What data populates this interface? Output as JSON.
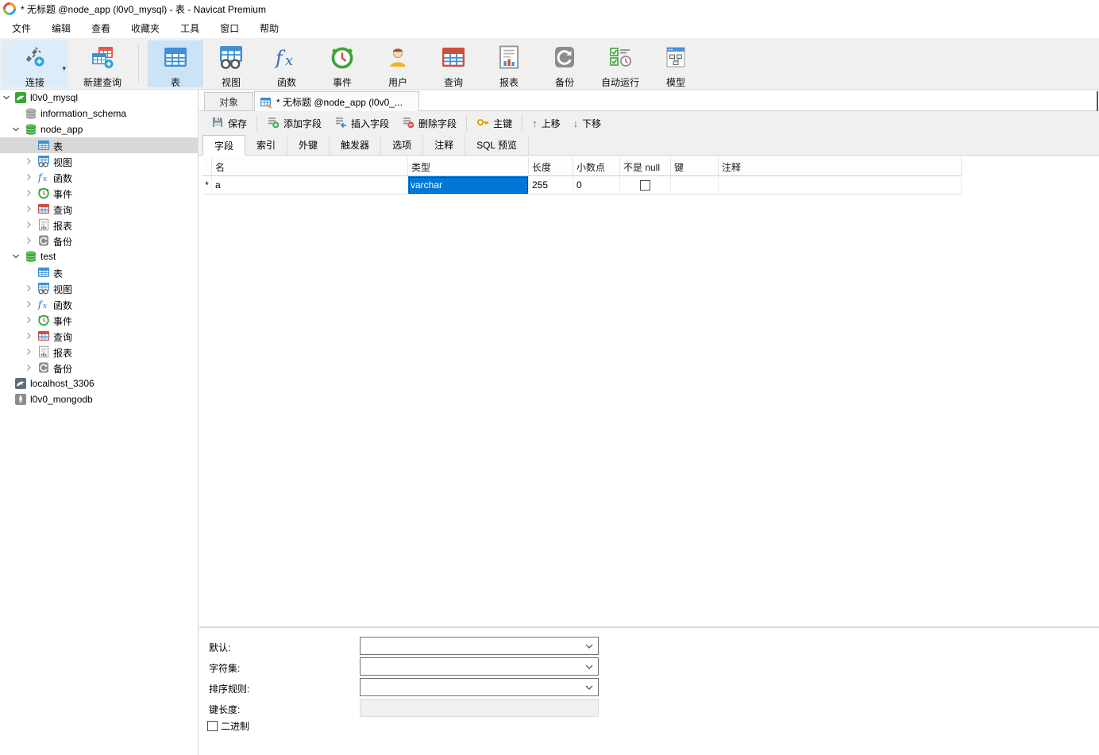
{
  "window": {
    "title": "* 无标题 @node_app (l0v0_mysql) - 表 - Navicat Premium",
    "app_icon": "navicat-logo-icon"
  },
  "menu_bar": {
    "items": [
      "文件",
      "编辑",
      "查看",
      "收藏夹",
      "工具",
      "窗口",
      "帮助"
    ]
  },
  "main_toolbar": {
    "left_items": [
      {
        "id": "connection",
        "icon": "connection-icon",
        "label": "连接",
        "has_dropdown": true,
        "highlighted": true
      },
      {
        "id": "new-query",
        "icon": "new-query-icon",
        "label": "新建查询"
      }
    ],
    "object_items": [
      {
        "id": "table",
        "icon": "table-icon",
        "label": "表",
        "selected": true
      },
      {
        "id": "view",
        "icon": "view-icon",
        "label": "视图"
      },
      {
        "id": "function",
        "icon": "function-icon",
        "label": "函数"
      },
      {
        "id": "event",
        "icon": "event-icon",
        "label": "事件"
      },
      {
        "id": "user",
        "icon": "user-icon",
        "label": "用户"
      },
      {
        "id": "query",
        "icon": "query-icon",
        "label": "查询"
      },
      {
        "id": "report",
        "icon": "report-icon",
        "label": "报表"
      },
      {
        "id": "backup",
        "icon": "backup-icon",
        "label": "备份"
      },
      {
        "id": "automation",
        "icon": "automation-icon",
        "label": "自动运行"
      },
      {
        "id": "model",
        "icon": "model-icon",
        "label": "模型"
      }
    ]
  },
  "sidebar": {
    "items": [
      {
        "depth": 0,
        "chevron": "expanded",
        "icon": "mysql-connection-icon",
        "label": "l0v0_mysql",
        "selected": false
      },
      {
        "depth": 1,
        "chevron": null,
        "icon": "database-gray-icon",
        "label": "information_schema",
        "selected": false
      },
      {
        "depth": 1,
        "chevron": "expanded",
        "icon": "database-green-icon",
        "label": "node_app",
        "selected": false
      },
      {
        "depth": 2,
        "chevron": null,
        "icon": "table-icon",
        "label": "表",
        "selected": true
      },
      {
        "depth": 2,
        "chevron": "collapsed",
        "icon": "view-icon",
        "label": "视图",
        "selected": false
      },
      {
        "depth": 2,
        "chevron": "collapsed",
        "icon": "function-icon",
        "label": "函数",
        "selected": false
      },
      {
        "depth": 2,
        "chevron": "collapsed",
        "icon": "event-icon",
        "label": "事件",
        "selected": false
      },
      {
        "depth": 2,
        "chevron": "collapsed",
        "icon": "query-icon",
        "label": "查询",
        "selected": false
      },
      {
        "depth": 2,
        "chevron": "collapsed",
        "icon": "report-icon",
        "label": "报表",
        "selected": false
      },
      {
        "depth": 2,
        "chevron": "collapsed",
        "icon": "backup-icon",
        "label": "备份",
        "selected": false
      },
      {
        "depth": 1,
        "chevron": "expanded",
        "icon": "database-green-icon",
        "label": "test",
        "selected": false
      },
      {
        "depth": 2,
        "chevron": null,
        "icon": "table-icon",
        "label": "表",
        "selected": false
      },
      {
        "depth": 2,
        "chevron": "collapsed",
        "icon": "view-icon",
        "label": "视图",
        "selected": false
      },
      {
        "depth": 2,
        "chevron": "collapsed",
        "icon": "function-icon",
        "label": "函数",
        "selected": false
      },
      {
        "depth": 2,
        "chevron": "collapsed",
        "icon": "event-icon",
        "label": "事件",
        "selected": false
      },
      {
        "depth": 2,
        "chevron": "collapsed",
        "icon": "query-icon",
        "label": "查询",
        "selected": false
      },
      {
        "depth": 2,
        "chevron": "collapsed",
        "icon": "report-icon",
        "label": "报表",
        "selected": false
      },
      {
        "depth": 2,
        "chevron": "collapsed",
        "icon": "backup-icon",
        "label": "备份",
        "selected": false
      },
      {
        "depth": 0,
        "chevron": null,
        "icon": "mysql-offline-icon",
        "label": "localhost_3306",
        "selected": false
      },
      {
        "depth": 0,
        "chevron": null,
        "icon": "mongodb-icon",
        "label": "l0v0_mongodb",
        "selected": false
      }
    ]
  },
  "doc_tabs": {
    "objects_tab": "对象",
    "active_tab": {
      "icon": "table-edit-icon",
      "label": "* 无标题 @node_app (l0v0_..."
    }
  },
  "doc_toolbar": {
    "items": [
      {
        "id": "save",
        "icon": "save-icon",
        "label": "保存",
        "sep_after": true
      },
      {
        "id": "add-field",
        "icon": "add-field-icon",
        "label": "添加字段",
        "sep_after": false
      },
      {
        "id": "insert-field",
        "icon": "insert-field-icon",
        "label": "插入字段",
        "sep_after": false
      },
      {
        "id": "delete-field",
        "icon": "delete-field-icon",
        "label": "删除字段",
        "sep_after": true
      },
      {
        "id": "primary-key",
        "icon": "key-icon",
        "label": "主键",
        "sep_after": true
      },
      {
        "id": "move-up",
        "icon": "arrow-up-icon",
        "label": "上移",
        "sep_after": false
      },
      {
        "id": "move-down",
        "icon": "arrow-down-icon",
        "label": "下移",
        "sep_after": false
      }
    ]
  },
  "field_tabs": {
    "active_index": 0,
    "items": [
      "字段",
      "索引",
      "外键",
      "触发器",
      "选项",
      "注释",
      "SQL 预览"
    ]
  },
  "fields_grid": {
    "columns": [
      "名",
      "类型",
      "长度",
      "小数点",
      "不是 null",
      "键",
      "注释"
    ],
    "rows": [
      {
        "marker": "*",
        "name": "a",
        "type": "varchar",
        "type_selected": true,
        "length": "255",
        "decimals": "0",
        "not_null": false,
        "key": "",
        "comment": ""
      }
    ]
  },
  "field_properties": {
    "default_label": "默认:",
    "charset_label": "字符集:",
    "collation_label": "排序规则:",
    "key_length_label": "键长度:",
    "binary_label": "二进制",
    "default_value": "",
    "charset_value": "",
    "collation_value": "",
    "key_length_value": "",
    "binary_checked": false
  },
  "colors": {
    "accent": "#0078d7",
    "toolbar_bg": "#f0f0f0",
    "selected_row_bg": "#d8d8d8",
    "connect_highlight": "#ddecf9",
    "table_button_highlight": "#cbe3f6"
  }
}
